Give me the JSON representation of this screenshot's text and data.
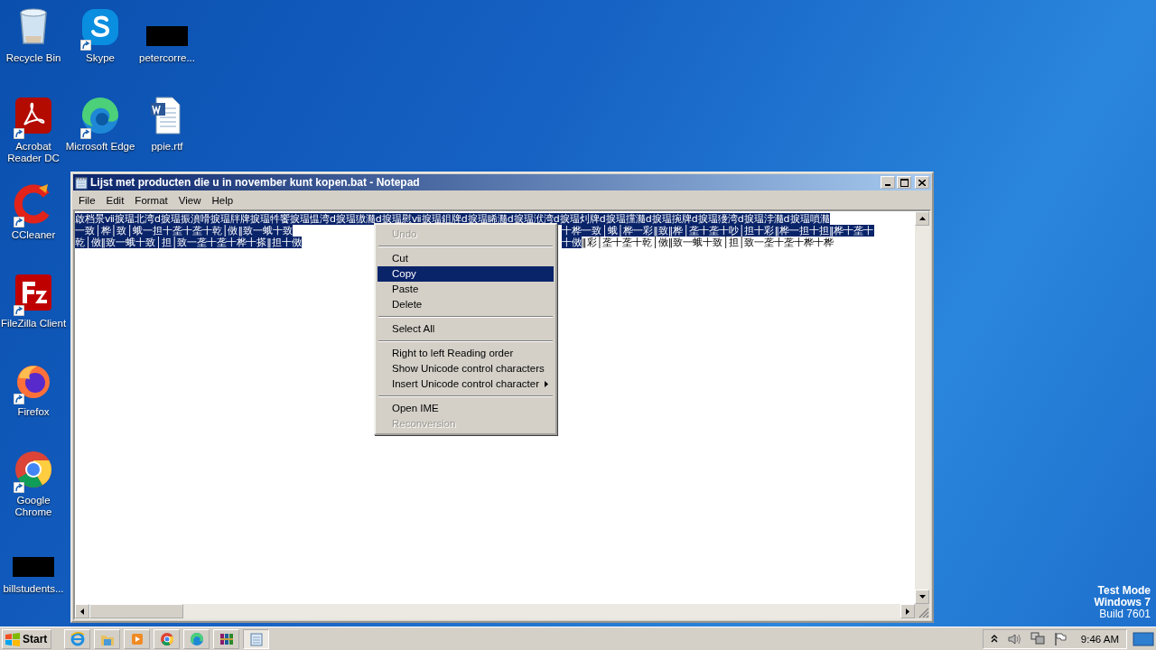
{
  "desktop": {
    "columns": [
      [
        {
          "label": "Recycle Bin",
          "kind": "recycle-bin",
          "shortcut": false
        },
        {
          "label": "Acrobat Reader DC",
          "kind": "acrobat",
          "shortcut": true
        },
        {
          "label": "CCleaner",
          "kind": "ccleaner",
          "shortcut": true
        },
        {
          "label": "FileZilla Client",
          "kind": "filezilla",
          "shortcut": true
        },
        {
          "label": "Firefox",
          "kind": "firefox",
          "shortcut": true
        },
        {
          "label": "Google Chrome",
          "kind": "chrome",
          "shortcut": true
        },
        {
          "label": "billstudents...",
          "kind": "redacted"
        }
      ],
      [
        {
          "label": "Skype",
          "kind": "skype",
          "shortcut": true
        },
        {
          "label": "Microsoft Edge",
          "kind": "edge",
          "shortcut": true
        }
      ],
      [
        {
          "label": "petercorre...",
          "kind": "redacted"
        },
        {
          "label": "ppie.rtf",
          "kind": "word-doc",
          "shortcut": false
        }
      ]
    ]
  },
  "notepad": {
    "title": "Lijst met producten die u in november kunt kopen.bat - Notepad",
    "menu": [
      "File",
      "Edit",
      "Format",
      "View",
      "Help"
    ],
    "lines": [
      {
        "left": [
          {
            "text": "啟档景ⅶ捩瑥北湾ⅾ捩瑥振濆嗗捩瑥牉牌捩瑥牪饗捩瑥愠湾ⅾ捩瑥獓瀡ⅾ捩瑥慰ⅶ捩瑥鉏牌ⅾ捩瑥睎瀡ⅾ捩瑥洑湾ⅾ捩瑥灲牌ⅾ捩瑥攩瀡ⅾ捩瑥捥牌ⅾ捩瑥獶湾ⅾ捩瑥浡瀡ⅾ捩瑥嗩瀡",
            "selected": true
          }
        ]
      },
      {
        "left": [
          {
            "text": "一致│桦│致│蛾一担十垄十垄十乾│傚‖致一蛾十致",
            "selected": true
          }
        ],
        "right": [
          {
            "text": "十桦一致│蛾│桦一彩‖致‖桦│垄十垄十吵│担十彩‖桦一担十担‖桦十垄十",
            "selected": true
          }
        ]
      },
      {
        "left": [
          {
            "text": "乾│傚‖致一蛾十致│担│致一垄十垄十桦十搽‖担十傚",
            "selected": true
          }
        ],
        "right": [
          {
            "text": "十傚",
            "selected": true
          },
          {
            "text": "‖彩│垄十垄十乾│傚‖致一蛾十致│担│致一垄十垄十桦十桦",
            "selected": false
          }
        ]
      }
    ]
  },
  "context_menu": [
    {
      "kind": "item",
      "label": "Undo",
      "disabled": true,
      "selected": false,
      "submenu": false
    },
    {
      "kind": "separator"
    },
    {
      "kind": "item",
      "label": "Cut",
      "disabled": false,
      "selected": false,
      "submenu": false
    },
    {
      "kind": "item",
      "label": "Copy",
      "disabled": false,
      "selected": true,
      "submenu": false
    },
    {
      "kind": "item",
      "label": "Paste",
      "disabled": false,
      "selected": false,
      "submenu": false
    },
    {
      "kind": "item",
      "label": "Delete",
      "disabled": false,
      "selected": false,
      "submenu": false
    },
    {
      "kind": "separator"
    },
    {
      "kind": "item",
      "label": "Select All",
      "disabled": false,
      "selected": false,
      "submenu": false
    },
    {
      "kind": "separator"
    },
    {
      "kind": "item",
      "label": "Right to left Reading order",
      "disabled": false,
      "selected": false,
      "submenu": false
    },
    {
      "kind": "item",
      "label": "Show Unicode control characters",
      "disabled": false,
      "selected": false,
      "submenu": false
    },
    {
      "kind": "item",
      "label": "Insert Unicode control character",
      "disabled": false,
      "selected": false,
      "submenu": true
    },
    {
      "kind": "separator"
    },
    {
      "kind": "item",
      "label": "Open IME",
      "disabled": false,
      "selected": false,
      "submenu": false
    },
    {
      "kind": "item",
      "label": "Reconversion",
      "disabled": true,
      "selected": false,
      "submenu": false
    }
  ],
  "os_notice": [
    "Test Mode",
    "Windows 7",
    "Build 7601"
  ],
  "taskbar": {
    "start": "Start",
    "apps": [
      {
        "kind": "ie",
        "selected": false
      },
      {
        "kind": "explorer",
        "selected": false
      },
      {
        "kind": "media",
        "selected": false
      },
      {
        "kind": "chrome",
        "selected": false
      },
      {
        "kind": "edge",
        "selected": false
      },
      {
        "kind": "winrar",
        "selected": false
      },
      {
        "kind": "notepad",
        "selected": true
      }
    ],
    "clock": "9:46 AM"
  }
}
